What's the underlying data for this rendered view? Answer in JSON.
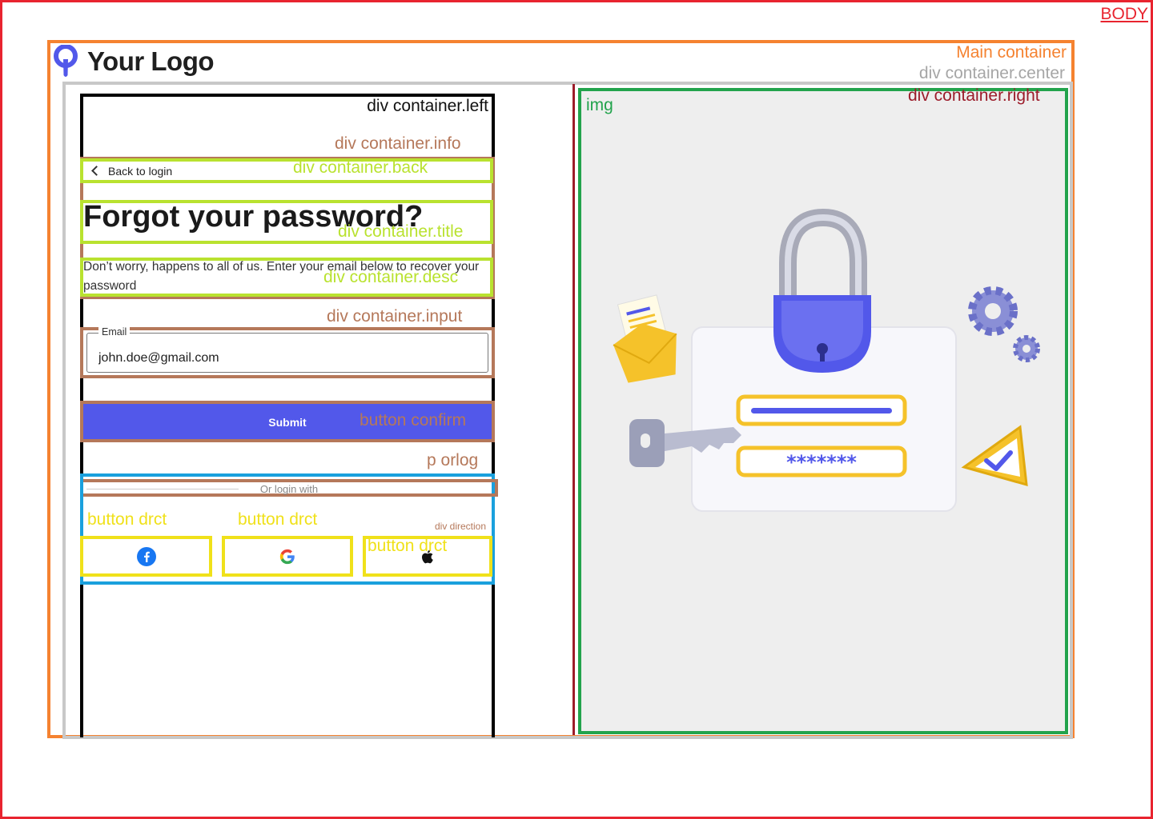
{
  "annotations": {
    "body": "BODY",
    "main_container": "Main container",
    "center_container": "div container.center",
    "left_container": "div container.left",
    "info_container": "div container.info",
    "back_container": "div container.back",
    "title_container": "div container.title",
    "desc_container": "div container.desc",
    "input_container": "div container.input",
    "confirm_button": "button confirm",
    "orlog": "p orlog",
    "direction": "div direction",
    "drct_button": "button drct",
    "right_container": "div container.right",
    "img": "img"
  },
  "logo": {
    "text": "Your Logo"
  },
  "back": {
    "label": "Back to login",
    "icon": "chevron-left-icon"
  },
  "title": "Forgot your password?",
  "description": "Don’t worry, happens to all of us. Enter your email below to recover your password",
  "email": {
    "label": "Email",
    "value": "john.doe@gmail.com"
  },
  "submit": {
    "label": "Submit"
  },
  "or_login_with": "Or login with",
  "social": [
    {
      "name": "facebook",
      "icon": "facebook-icon"
    },
    {
      "name": "google",
      "icon": "google-icon"
    },
    {
      "name": "apple",
      "icon": "apple-icon"
    }
  ],
  "illustration": {
    "password_mask": "*******"
  },
  "colors": {
    "brand": "#5258ea",
    "annotation_body": "#e8242f",
    "annotation_main": "#f58230",
    "annotation_center": "#c8c8c8",
    "annotation_info": "#b5785a",
    "annotation_sub": "#b9e22f",
    "annotation_direction": "#1aa0dd",
    "annotation_button": "#f0e11a",
    "annotation_right": "#9c1c2a",
    "annotation_img": "#22a34c"
  }
}
